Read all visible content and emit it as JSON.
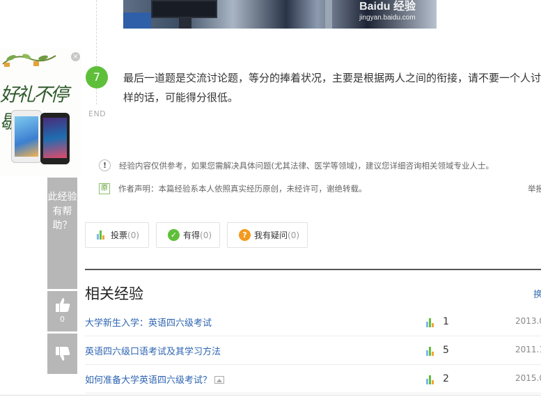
{
  "photo": {
    "watermark_brand": "Baidu 经验",
    "watermark_url": "jingyan.baidu.com"
  },
  "step": {
    "number": "7",
    "text": "最后一道题是交流讨论题，等分的捧着状况，主要是根据两人之间的衔接，请不要一个人讨论这样的话，可能得分很低。",
    "end_label": "END"
  },
  "notice": {
    "disclaimer_icon_text": "!",
    "disclaimer": "经验内容仅供参考，如果您需解决具体问题(尤其法律、医学等领域)，建议您详细咨询相关领域专业人士。",
    "original_icon_text": "原",
    "author_statement": "作者声明：本篇经验系本人依照真实经历原创，未经许可，谢绝转载。",
    "report_label": "举报"
  },
  "votes": {
    "vote": {
      "label": "投票",
      "count": "(0)"
    },
    "useful": {
      "label": "有得",
      "count": "(0)"
    },
    "question": {
      "label": "我有疑问",
      "count": "(0)"
    }
  },
  "related": {
    "title": "相关经验",
    "change_label": "换",
    "items": [
      {
        "title": "大学新生入学：英语四六级考试",
        "votes": "1",
        "date": "2013.0"
      },
      {
        "title": "英语四六级口语考试及其学习方法",
        "votes": "5",
        "date": "2011.1"
      },
      {
        "title": "如何准备大学英语四六级考试？",
        "votes": "2",
        "date": "2015.0"
      }
    ]
  },
  "ad": {
    "title": "好礼不停歇",
    "close_label": "×"
  },
  "feedback": {
    "question": "此经验有帮助？",
    "up_count": "0"
  },
  "colors": {
    "step_green": "#5fbf3a",
    "link_blue": "#2d64b3",
    "feedback_gray": "#b7b7b7"
  }
}
